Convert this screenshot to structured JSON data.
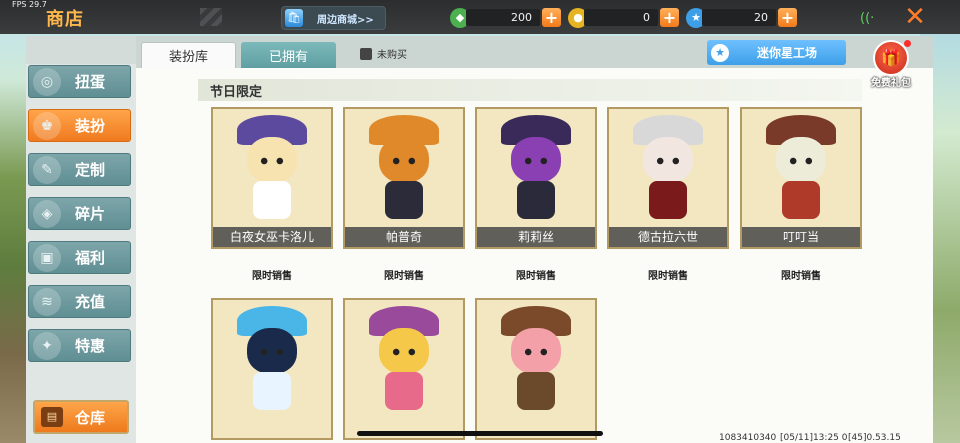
{
  "topbar": {
    "fps": "FPS 29.7",
    "title": "商店",
    "mall_label": "周边商城>>",
    "currencies": [
      {
        "name": "green-gem",
        "value": "200",
        "color": "#4caf50"
      },
      {
        "name": "gold-coin",
        "value": "0",
        "color": "#e6b422"
      },
      {
        "name": "blue-star",
        "value": "20",
        "color": "#3d9fe8"
      }
    ],
    "plus_symbol": "+",
    "close_symbol": "✕"
  },
  "sidebar": {
    "items": [
      {
        "label": "扭蛋",
        "icon": "capsule-icon",
        "active": false
      },
      {
        "label": "装扮",
        "icon": "outfit-icon",
        "active": true
      },
      {
        "label": "定制",
        "icon": "brush-icon",
        "active": false
      },
      {
        "label": "碎片",
        "icon": "fragment-icon",
        "active": false
      },
      {
        "label": "福利",
        "icon": "gift-icon",
        "active": false
      },
      {
        "label": "充值",
        "icon": "coins-icon",
        "active": false
      },
      {
        "label": "特惠",
        "icon": "discount-icon",
        "active": false
      }
    ],
    "warehouse_label": "仓库"
  },
  "tabs": {
    "tab1": "装扮库",
    "tab2": "已拥有",
    "unbought": "未购买"
  },
  "workshop_label": "迷你星工场",
  "gift_label": "免费礼包",
  "section_title": "节日限定",
  "items": [
    {
      "name": "白夜女巫卡洛儿",
      "sale": "限时销售",
      "palette": {
        "hat": "#5b4a9e",
        "head": "#f7e3b0",
        "body": "#ffffff"
      }
    },
    {
      "name": "帕普奇",
      "sale": "限时销售",
      "palette": {
        "hat": "#e0892a",
        "head": "#e0892a",
        "body": "#2b2b3a"
      }
    },
    {
      "name": "莉莉丝",
      "sale": "限时销售",
      "palette": {
        "hat": "#3a2a5a",
        "head": "#8a3fb3",
        "body": "#2a2a3a"
      }
    },
    {
      "name": "德古拉六世",
      "sale": "限时销售",
      "palette": {
        "hat": "#d8d8d8",
        "head": "#f2e6e0",
        "body": "#7a1a1a"
      }
    },
    {
      "name": "叮叮当",
      "sale": "限时销售",
      "palette": {
        "hat": "#7a3a2a",
        "head": "#ececd8",
        "body": "#b03a2a"
      }
    },
    {
      "name": "",
      "sale": "",
      "palette": {
        "hat": "#4ab6e8",
        "head": "#1a2a4a",
        "body": "#e8f4ff"
      }
    },
    {
      "name": "",
      "sale": "",
      "palette": {
        "hat": "#9a4a9a",
        "head": "#f6c84a",
        "body": "#e86a8a"
      }
    },
    {
      "name": "",
      "sale": "",
      "palette": {
        "hat": "#7a4a2a",
        "head": "#f4a0a8",
        "body": "#6a4a2a"
      }
    }
  ],
  "footer": {
    "id": "1083410340",
    "time": "[05/11]13:25 0",
    "version": "[45]0.53.15"
  }
}
